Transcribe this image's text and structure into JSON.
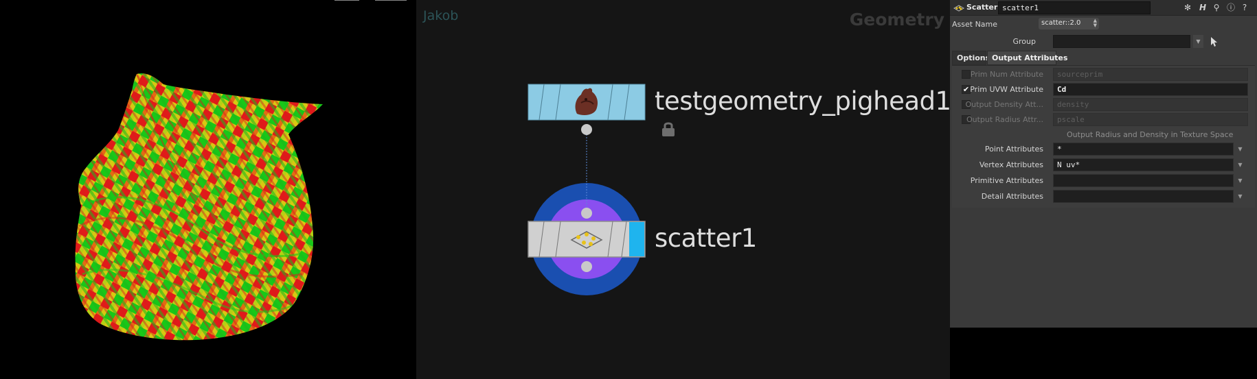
{
  "viewport": {
    "subject": "pighead-uv-colored-mesh",
    "colors": {
      "red": "#e11a1a",
      "green": "#18c818",
      "yellow": "#d9c712",
      "background": "#000000"
    }
  },
  "network": {
    "user": "Jakob",
    "context": "Geometry",
    "nodes": [
      {
        "name": "testgeometry_pighead1",
        "type": "testgeometry",
        "color": "#8ccbe4",
        "locked": true
      },
      {
        "name": "scatter1",
        "type": "scatter",
        "color": "#cfcfcf",
        "selected": true,
        "display_flag_color": "#1fb4ee",
        "ring_outer": "#1a4fb0",
        "ring_inner": "#8a4ff0"
      }
    ]
  },
  "params": {
    "header": {
      "type": "Scatter",
      "name": "scatter1"
    },
    "asset_label": "Asset Name",
    "asset_value": "scatter::2.0",
    "group_label": "Group",
    "group_value": "",
    "tabs": [
      {
        "label": "Options",
        "active": false
      },
      {
        "label": "Output Attributes",
        "active": true
      }
    ],
    "rows": [
      {
        "label": "Prim Num Attribute",
        "value": "sourceprim",
        "checked": false
      },
      {
        "label": "Prim UVW Attribute",
        "value": "Cd",
        "checked": true
      },
      {
        "label": "Output Density Att...",
        "value": "density",
        "checked": false
      },
      {
        "label": "Output Radius Attr...",
        "value": "pscale",
        "checked": false
      }
    ],
    "density_toggle": "Output Radius and Density in Texture Space",
    "attr_rows": [
      {
        "label": "Point Attributes",
        "value": "*"
      },
      {
        "label": "Vertex Attributes",
        "value": "N uv*"
      },
      {
        "label": "Primitive Attributes",
        "value": ""
      },
      {
        "label": "Detail Attributes",
        "value": ""
      }
    ]
  }
}
